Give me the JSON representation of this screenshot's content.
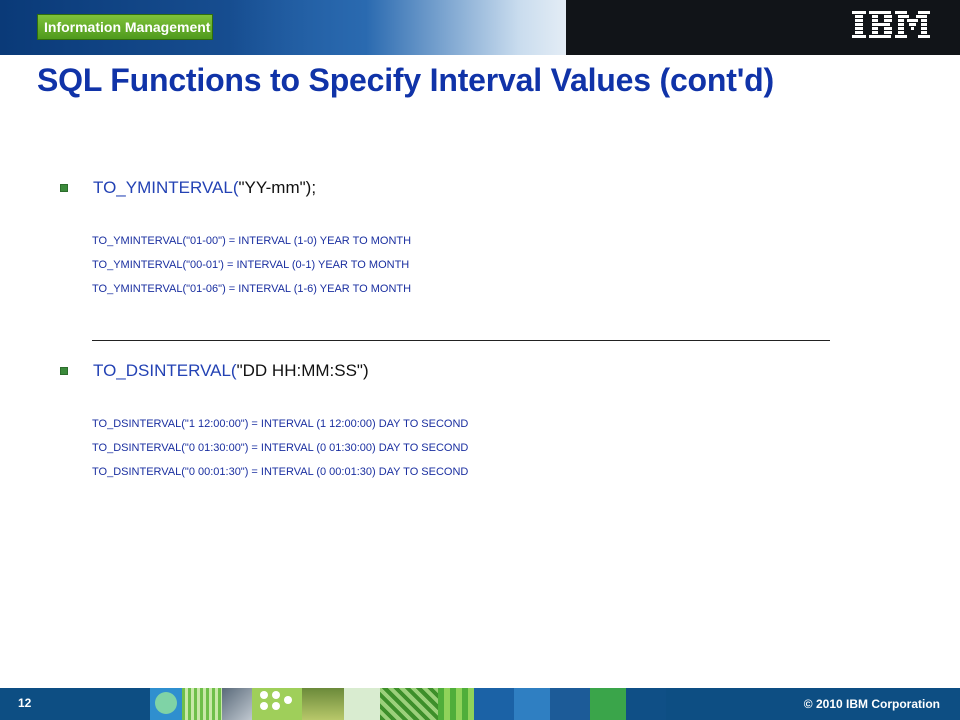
{
  "header": {
    "brand_label": "Information Management",
    "logo_text": "IBM",
    "colors": {
      "banner": "#1f5aa0",
      "badge": "#5fa62a"
    }
  },
  "title": "SQL Functions to Specify Interval Values (cont'd)",
  "sections": [
    {
      "bullet_prefix": "TO_YMINTERVAL(",
      "bullet_args": "\"YY-mm\");",
      "lines": [
        "TO_YMINTERVAL(\"01-00\")    = INTERVAL  (1-0)  YEAR TO MONTH",
        "TO_YMINTERVAL(\"00-01')    = INTERVAL  (0-1)  YEAR TO MONTH",
        "TO_YMINTERVAL(\"01-06\")    = INTERVAL  (1-6)  YEAR TO MONTH"
      ]
    },
    {
      "bullet_prefix": "TO_DSINTERVAL(",
      "bullet_args": "\"DD  HH:MM:SS\")",
      "lines": [
        "TO_DSINTERVAL(\"1  12:00:00\")  =  INTERVAL  (1 12:00:00)  DAY TO SECOND",
        "TO_DSINTERVAL(\"0  01:30:00\")  =  INTERVAL  (0 01:30:00)  DAY TO SECOND",
        "TO_DSINTERVAL(\"0  00:01:30\")  =  INTERVAL  (0 00:01:30)  DAY TO SECOND"
      ]
    }
  ],
  "footer": {
    "page_number": "12",
    "copyright": "© 2010 IBM Corporation",
    "color": "#0d4e83"
  }
}
